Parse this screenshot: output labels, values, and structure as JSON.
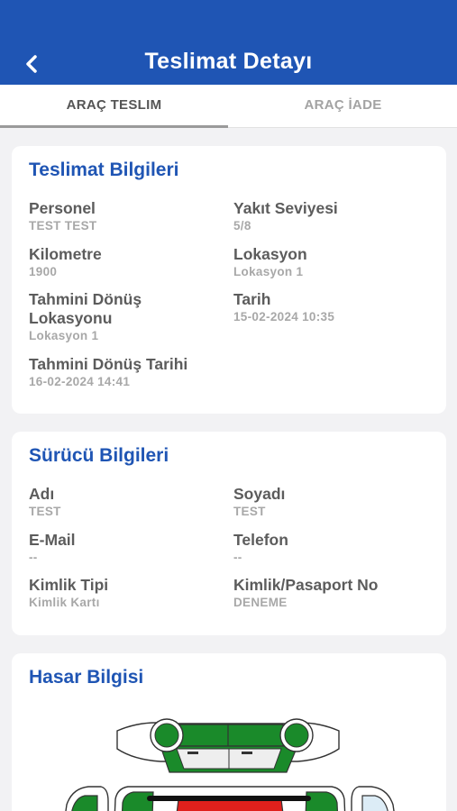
{
  "header": {
    "title": "Teslimat Detayı"
  },
  "tabs": [
    {
      "label": "ARAÇ TESLIM"
    },
    {
      "label": "ARAÇ İADE"
    }
  ],
  "delivery": {
    "title": "Teslimat Bilgileri",
    "personnel_label": "Personel",
    "personnel_value": "TEST TEST",
    "fuel_label": "Yakıt Seviyesi",
    "fuel_value": "5/8",
    "km_label": "Kilometre",
    "km_value": "1900",
    "location_label": "Lokasyon",
    "location_value": "Lokasyon 1",
    "est_location_label": "Tahmini Dönüş Lokasyonu",
    "est_location_value": "Lokasyon 1",
    "date_label": "Tarih",
    "date_value": "15-02-2024 10:35",
    "est_date_label": "Tahmini Dönüş Tarihi",
    "est_date_value": "16-02-2024 14:41"
  },
  "driver": {
    "title": "Sürücü Bilgileri",
    "name_label": "Adı",
    "name_value": "TEST",
    "surname_label": "Soyadı",
    "surname_value": "TEST",
    "email_label": "E-Mail",
    "email_value": "--",
    "phone_label": "Telefon",
    "phone_value": "--",
    "id_type_label": "Kimlik Tipi",
    "id_type_value": "Kimlik Kartı",
    "id_no_label": "Kimlik/Pasaport No",
    "id_no_value": "DENEME"
  },
  "damage": {
    "title": "Hasar Bilgisi"
  },
  "colors": {
    "primary": "#1f55b4",
    "ok_part": "#1a8a2a",
    "damaged_part": "#e0201c"
  }
}
